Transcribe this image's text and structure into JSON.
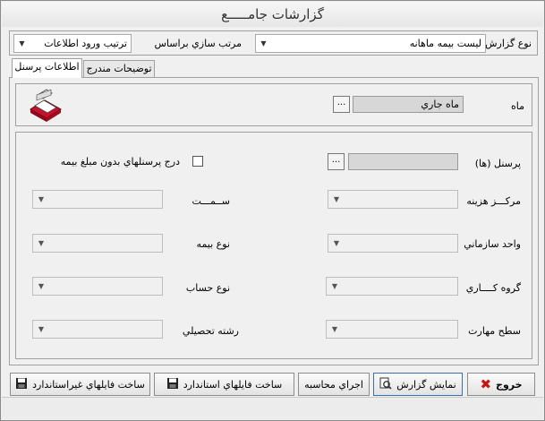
{
  "window": {
    "title": "گزارشات جامـــــع"
  },
  "top": {
    "report_type_label": "نوع گزارش",
    "report_type_value": "ليست بيمه ماهانه",
    "sort_label": "مرتب سازي براساس",
    "sort_value": "ترتيب ورود اطلاعات"
  },
  "tabs": [
    {
      "label": "اطلاعات پرسنل",
      "active": true
    },
    {
      "label": "توضيحات مندرج",
      "active": false
    }
  ],
  "month": {
    "label": "ماه",
    "value": "ماه جاري",
    "dots": "..."
  },
  "personnel": {
    "label": "پرسنل (ها)",
    "dots": "...",
    "checkbox_label": "درج پرسنلهاي بدون مبلغ بيمه",
    "checked": false
  },
  "filters": {
    "cost_center": "مرکـــز هزينه",
    "position": "ســمـــت",
    "org_unit": "واحد سازماني",
    "insurance_type": "نوع بيمه",
    "work_group": "گروه کــــاري",
    "account_type": "نوع حساب",
    "skill_level": "سطح مهارت",
    "education_field": "رشته تحصيلي"
  },
  "buttons": {
    "exit": "خروج",
    "show_report": "نمايش گزارش",
    "run_calc": "اجراي محاسبه",
    "std_files": "ساخت فايلهاي استاندارد",
    "nonstd_files": "ساخت فايلهاي غيراستاندارد"
  },
  "colors": {
    "exit_icon": "#cc1111",
    "printer_red": "#c8102e"
  }
}
